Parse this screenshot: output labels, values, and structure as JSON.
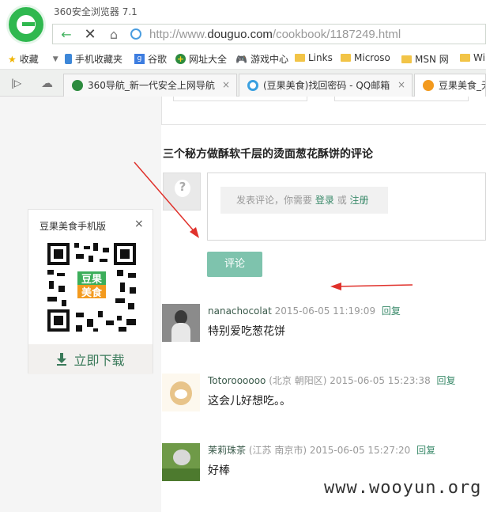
{
  "browser": {
    "app_title": "360安全浏览器 7.1",
    "url_prefix": "http://www.",
    "url_domain": "douguo.com",
    "url_path": "/cookbook/1187249.html"
  },
  "bookmarks": [
    {
      "label": "收藏",
      "icon": "star-icon"
    },
    {
      "label": "手机收藏夹",
      "icon": "phone-icon"
    },
    {
      "label": "谷歌",
      "icon": "google-icon"
    },
    {
      "label": "网址大全",
      "icon": "plus-icon"
    },
    {
      "label": "游戏中心",
      "icon": "gamepad-icon"
    },
    {
      "label": "Links",
      "icon": "folder-icon"
    },
    {
      "label": "Microso",
      "icon": "folder-icon"
    },
    {
      "label": "MSN 网",
      "icon": "folder-icon"
    },
    {
      "label": "Wi",
      "icon": "folder-icon"
    }
  ],
  "tabs": [
    {
      "label": "360导航_新一代安全上网导航",
      "icon": "360-icon"
    },
    {
      "label": "(豆果美食)找回密码 - QQ邮箱",
      "icon": "qq-mail-icon"
    },
    {
      "label": "豆果美食_无",
      "icon": "douguo-icon"
    }
  ],
  "page": {
    "section_title": "三个秘方做酥软千层的烫面葱花酥饼的评论",
    "login_hint_prefix": "发表评论，你需要",
    "login_link": "登录",
    "or_text": "或",
    "register_link": "注册",
    "submit_label": "评论",
    "comments": [
      {
        "user": "nanachocolat",
        "location": "",
        "time": "2015-06-05 11:19:09",
        "reply": "回复",
        "text": "特别爱吃葱花饼"
      },
      {
        "user": "Totoroooooo",
        "location": "(北京 朝阳区)",
        "time": "2015-06-05 15:23:38",
        "reply": "回复",
        "text": "这会儿好想吃。。"
      },
      {
        "user": "茉莉珠茶",
        "location": "(江苏 南京市)",
        "time": "2015-06-05 15:27:20",
        "reply": "回复",
        "text": "好棒"
      }
    ]
  },
  "sidebar": {
    "qr_title": "豆果美食手机版",
    "close": "×",
    "download_label": "立即下载"
  },
  "watermark": "www.wooyun.org",
  "colors": {
    "accent": "#7ec3ad",
    "link": "#3a8a6a",
    "arrow": "#e0312b"
  }
}
